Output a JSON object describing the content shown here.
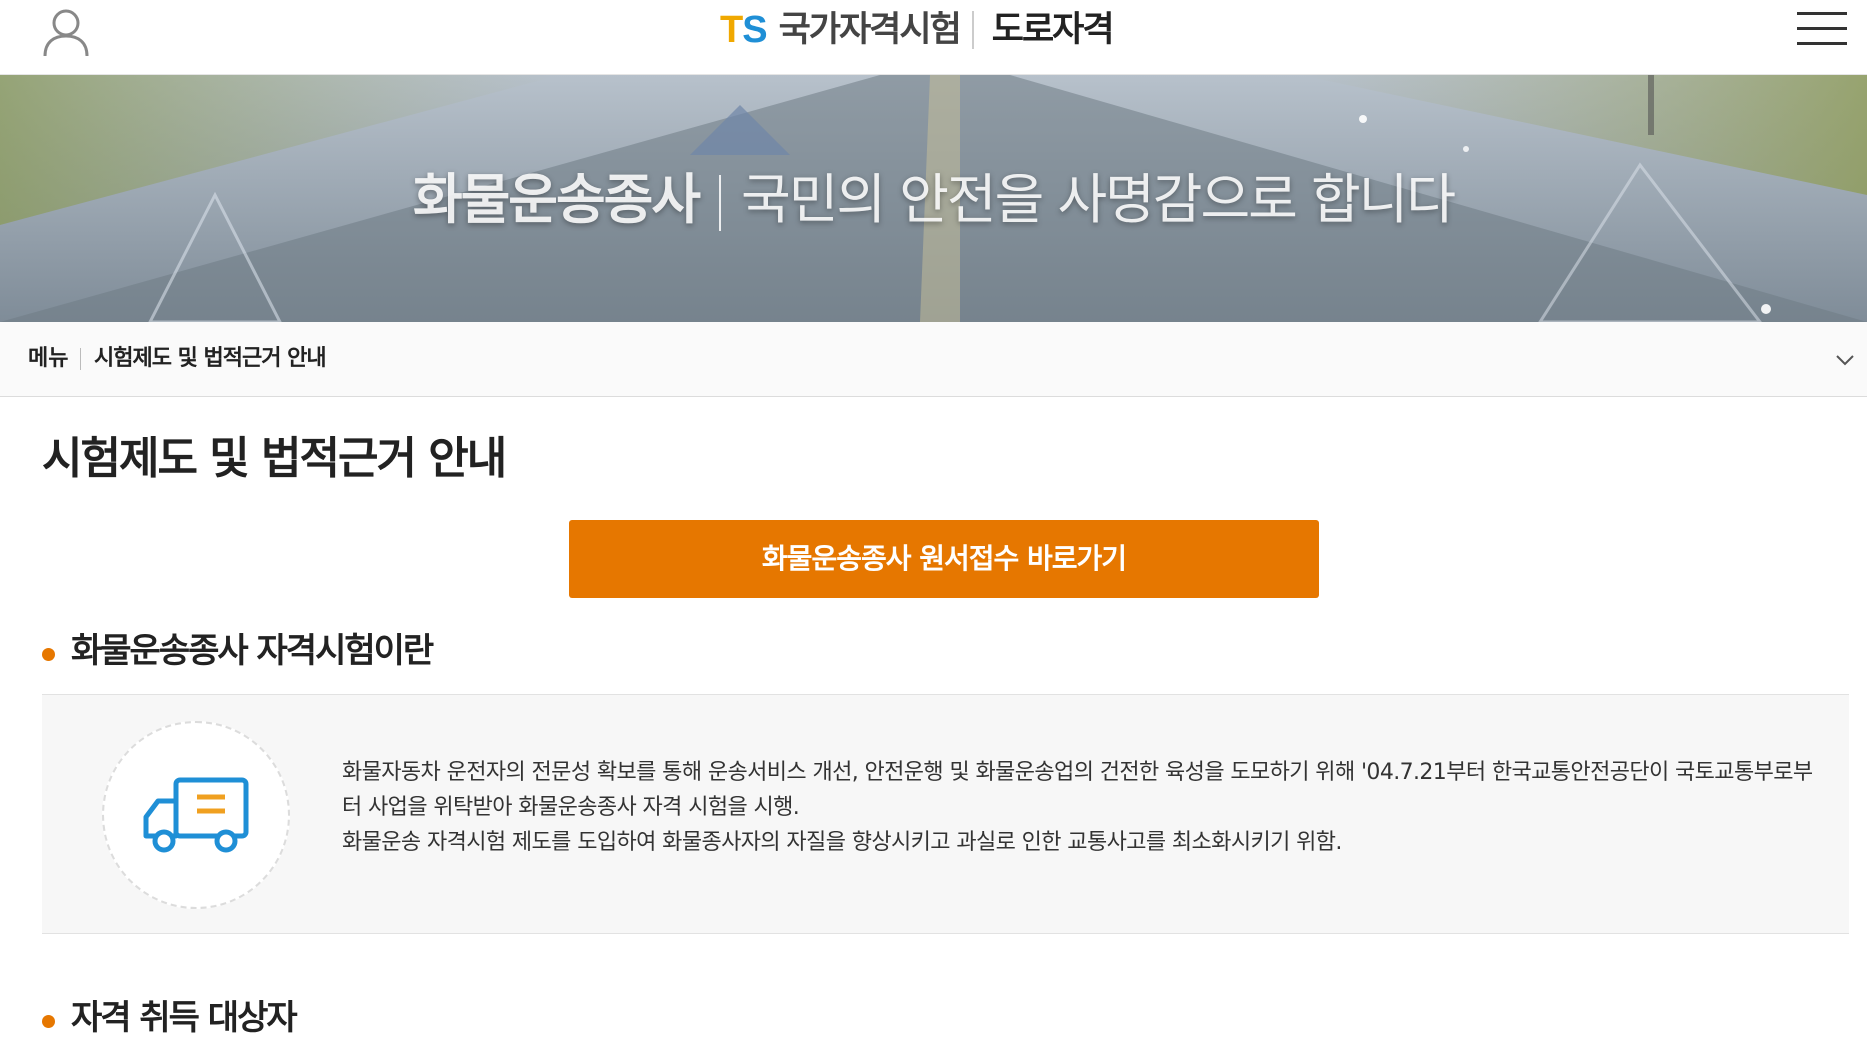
{
  "header": {
    "logo_ts_t": "T",
    "logo_ts_s": "S",
    "logo_name": "국가자격시험",
    "logo_sub": "도로자격",
    "user_icon": "user-icon",
    "menu_icon": "hamburger-menu-icon"
  },
  "banner": {
    "strong": "화물운송종사",
    "tagline": "국민의 안전을 사명감으로 합니다"
  },
  "breadcrumb": {
    "menu_label": "메뉴",
    "current": "시험제도 및 법적근거 안내",
    "toggle_icon": "chevron-down-icon"
  },
  "main": {
    "title": "시험제도 및 법적근거 안내",
    "apply_button": "화물운송종사 원서접수 바로가기",
    "sections": [
      {
        "title": "화물운송종사 자격시험이란",
        "icon": "truck-icon",
        "paragraphs": [
          "화물자동차 운전자의 전문성 확보를 통해 운송서비스 개선, 안전운행 및 화물운송업의 건전한 육성을 도모하기 위해 '04.7.21부터 한국교통안전공단이 국토교통부로부터 사업을 위탁받아 화물운송종사 자격 시험을 시행.",
          "화물운송 자격시험 제도를 도입하여 화물종사자의 자질을 향상시키고 과실로 인한 교통사고를 최소화시키기 위함."
        ]
      },
      {
        "title": "자격 취득 대상자"
      }
    ]
  },
  "colors": {
    "accent": "#e67700",
    "logo_orange": "#f0a800",
    "logo_blue": "#1f8fd6",
    "truck_blue": "#1f8fd6"
  }
}
